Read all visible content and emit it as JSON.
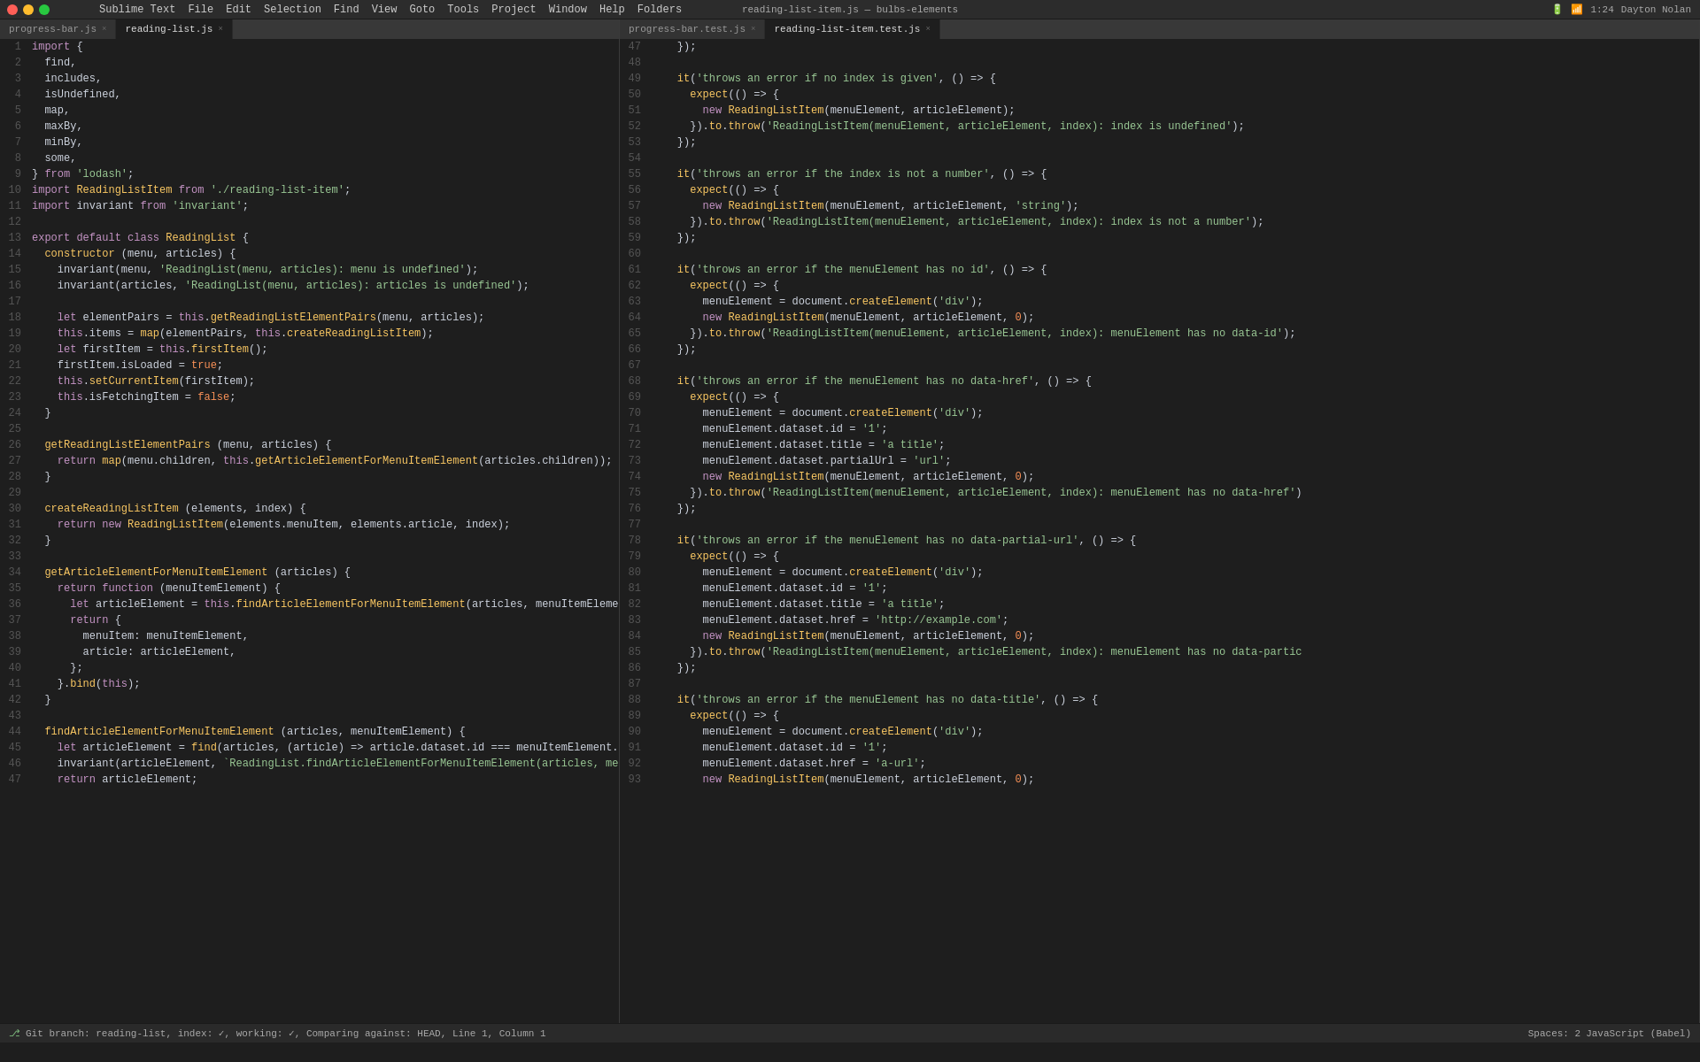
{
  "titlebar": {
    "title": "reading-list-item.js — bulbs-elements",
    "menus": [
      "Sublime Text",
      "File",
      "Edit",
      "Selection",
      "Find",
      "View",
      "Goto",
      "Tools",
      "Project",
      "Window",
      "Help",
      "Folders"
    ]
  },
  "left_tabs": [
    {
      "label": "progress-bar.js",
      "active": false
    },
    {
      "label": "reading-list.js",
      "active": true
    }
  ],
  "right_tabs": [
    {
      "label": "progress-bar.test.js",
      "active": false
    },
    {
      "label": "reading-list-item.test.js",
      "active": true
    }
  ],
  "statusbar": {
    "git": "Git branch: reading-list, index: ✓, working: ✓, Comparing against: HEAD, Line 1, Column 1",
    "right": "Spaces: 2    JavaScript (Babel)"
  },
  "colors": {
    "background": "#1e1e1e",
    "line_highlight": "#2d2d2d"
  }
}
